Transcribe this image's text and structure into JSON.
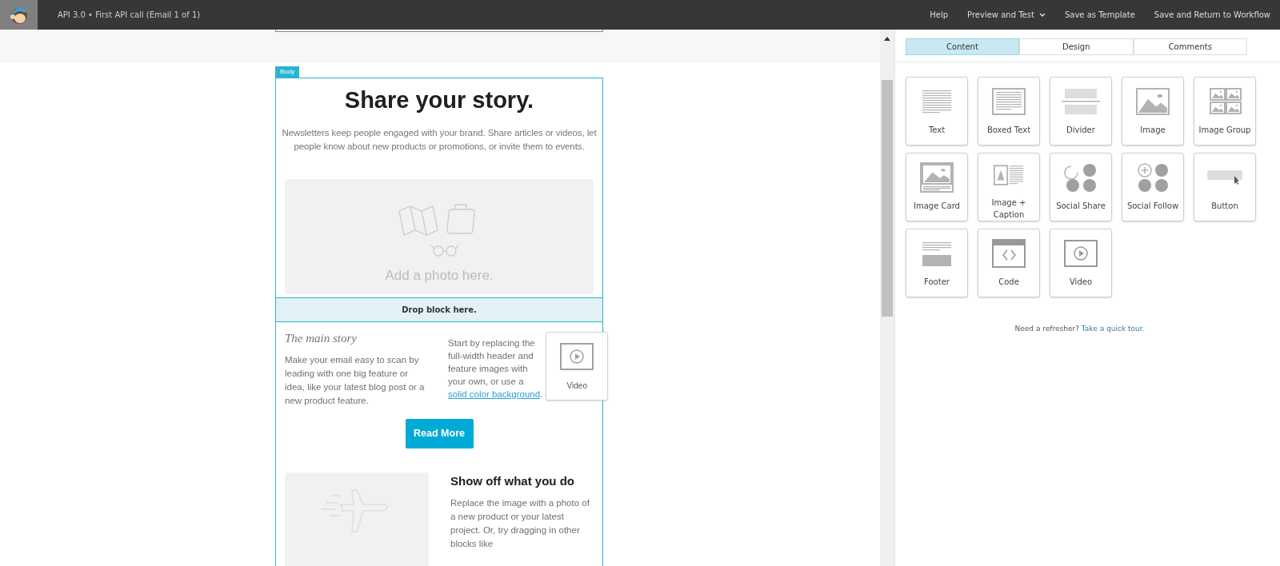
{
  "topbar": {
    "title": "API 3.0 • First API call (Email 1 of 1)",
    "menu": [
      {
        "label": "Help",
        "dropdown": false
      },
      {
        "label": "Preview and Test",
        "dropdown": true
      },
      {
        "label": "Save as Template",
        "dropdown": false
      },
      {
        "label": "Save and Return to Workflow",
        "dropdown": false
      }
    ]
  },
  "email": {
    "section_tag": "Body",
    "heading": "Share your story.",
    "intro": "Newsletters keep people engaged with your brand. Share articles or videos, let people know about new products or promotions, or invite them to events.",
    "photo_placeholder": "Add a photo here.",
    "drop_zone": "Drop block here.",
    "story_title": "The main story",
    "story_left": "Make your email easy to scan by leading with one big feature or idea, like your latest blog post or a new product feature.",
    "story_right": "Start by replacing the full-width header and feature images with your own, or use a",
    "story_link": "solid color background",
    "story_end": ".",
    "button": "Read More",
    "feature_title": "Show off what you do",
    "feature_text": "Replace the image with a photo of a new product or your latest project. Or, try dragging in other blocks like"
  },
  "drag_tile": {
    "label": "Video",
    "kind": "video"
  },
  "panel": {
    "tabs": [
      {
        "label": "Content",
        "selected": true
      },
      {
        "label": "Design",
        "selected": false
      },
      {
        "label": "Comments",
        "selected": false
      }
    ],
    "blocks": [
      {
        "label": "Text",
        "kind": "text"
      },
      {
        "label": "Boxed Text",
        "kind": "boxed"
      },
      {
        "label": "Divider",
        "kind": "divider"
      },
      {
        "label": "Image",
        "kind": "image"
      },
      {
        "label": "Image Group",
        "kind": "group"
      },
      {
        "label": "Image Card",
        "kind": "card"
      },
      {
        "label": "Image + Caption",
        "kind": "caption"
      },
      {
        "label": "Social Share",
        "kind": "share"
      },
      {
        "label": "Social Follow",
        "kind": "follow"
      },
      {
        "label": "Button",
        "kind": "button"
      },
      {
        "label": "Footer",
        "kind": "footer"
      },
      {
        "label": "Code",
        "kind": "code"
      },
      {
        "label": "Video",
        "kind": "video"
      }
    ],
    "help_text": "Need a refresher?",
    "help_link": "Take a quick tour."
  }
}
